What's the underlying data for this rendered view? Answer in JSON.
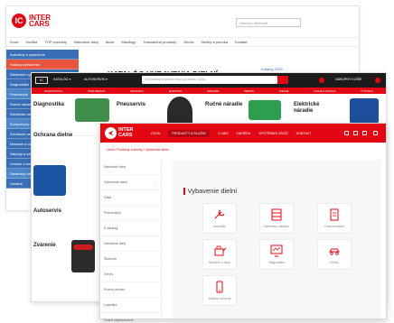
{
  "brand": {
    "name": "INTER CARS",
    "mark": "IC",
    "red": "#e30613",
    "dark": "#1b1b1b",
    "blue": "#3a6fb7"
  },
  "back_window": {
    "search_placeholder": "Hľadaj v obchode",
    "nav": [
      "Úvod",
      "Vozidlá",
      "TOP produkty",
      "Náhradné diely",
      "Akcie",
      "Katalógy",
      "Transakčné produkty",
      "Servis",
      "Služby a ponuka",
      "Kontakt"
    ],
    "sidebar": [
      {
        "label": "Autodiely a vybavenie",
        "style": "blue"
      },
      {
        "label": "Katalóg vybavenia",
        "style": "red"
      },
      {
        "label": "Dielenské vybavenie a nástroje",
        "style": "blue"
      },
      {
        "label": "Diagnostika",
        "style": "blue"
      },
      {
        "label": "Pneuservis",
        "style": "lblue"
      },
      {
        "label": "Ručné náradie",
        "style": "blue"
      },
      {
        "label": "Elektrické náradie",
        "style": "blue"
      },
      {
        "label": "Kompresory",
        "style": "lblue"
      },
      {
        "label": "Zdvíhacie zariadenia",
        "style": "blue"
      },
      {
        "label": "Mazanie a údržba",
        "style": "blue"
      },
      {
        "label": "Nádoby a zásobníky",
        "style": "blue"
      },
      {
        "label": "Vzduch a kompresory",
        "style": "blue"
      },
      {
        "label": "Dielenský nábytok",
        "style": "lblue"
      },
      {
        "label": "Ostatné",
        "style": "blue"
      }
    ],
    "page_title": "KATALÓG VYBAVENIA DIELNÍ",
    "links": [
      "Katalóg 2019",
      "Katalóg 2018",
      "Akciový leták"
    ]
  },
  "middle_window": {
    "logo": "IC",
    "top_links": [
      "KATALÓG ▾",
      "AUTOSERVIS ▾"
    ],
    "search_placeholder": "Vyhľadávanie podľa názvu produktu, kódu...",
    "search_category": "Všetky kategórie",
    "cart_label": "NÁKUPNÝ KOŠÍK",
    "categories": [
      "DIAGNOSTIKA",
      "PNEUSERVIS",
      "ZDVIHÁKY",
      "ELEKTRO",
      "NÁRADIE",
      "SERVIS",
      "DIELNE",
      "OLEJE A MAZIVÁ",
      "VÝSTROJ"
    ],
    "tiles": [
      {
        "name": "Diagnostika"
      },
      {
        "name": "Pneuservis"
      },
      {
        "name": "Ručné náradie"
      },
      {
        "name": "Elektrické náradie"
      }
    ],
    "left_items": [
      "Ochrana dielne",
      "Autoservis",
      "Zvárenie"
    ]
  },
  "front_window": {
    "logo_text": "INTER CARS",
    "menu": [
      "ÚVOD",
      "PRODUKTY A SLUŽBY",
      "O NÁS",
      "KARIÉRA",
      "SPOTŘEBNÍ ZBOŽÍ",
      "KONTAKT"
    ],
    "active_menu": "PRODUKTY A SLUŽBY",
    "breadcrumb": "Úvod / Produkty a služby / Vybavenie dielní",
    "sidebar": [
      "Náhradné diely",
      "Vybavenie dielní",
      "Oleje",
      "Pneumatiky",
      "E-katalóg",
      "Náhradné diely",
      "Školenia",
      "Servis",
      "Rozvoj servisu",
      "Logistika",
      "Online objednávanie"
    ],
    "panel_title": "Vybavenie dielní",
    "cards": [
      {
        "label": "Autodiely",
        "icon": "wrench-icon"
      },
      {
        "label": "Dielenský nábytok",
        "icon": "cabinet-icon"
      },
      {
        "label": "Dokumentácia",
        "icon": "document-icon"
      },
      {
        "label": "Mazanie a oleje",
        "icon": "oil-can-icon"
      },
      {
        "label": "Diagnostika",
        "icon": "monitor-icon"
      },
      {
        "label": "Zdvihy",
        "icon": "car-lift-icon"
      },
      {
        "label": "Mobilné riešenia",
        "icon": "phone-icon"
      }
    ]
  }
}
